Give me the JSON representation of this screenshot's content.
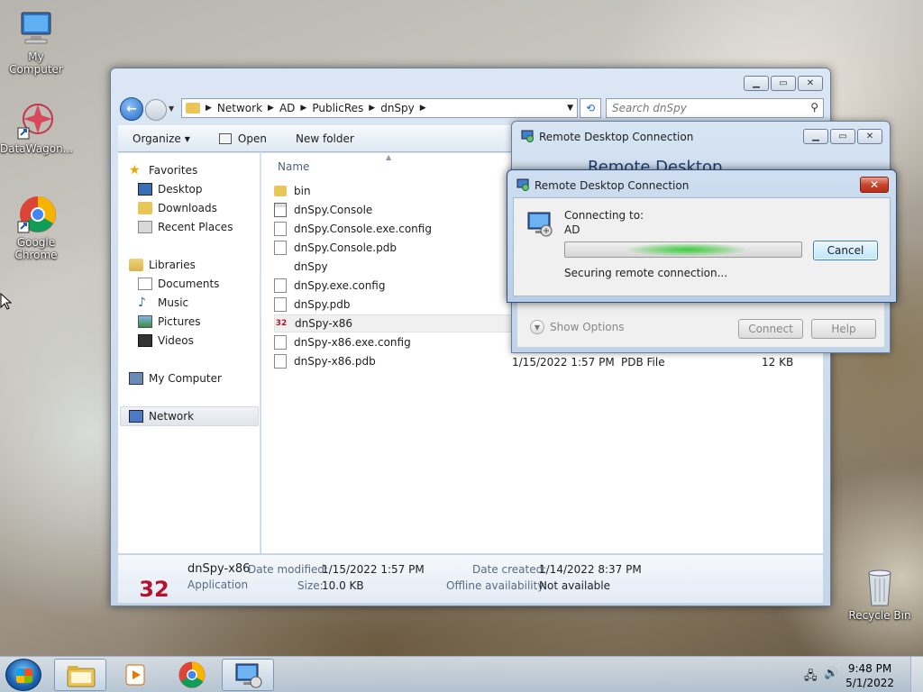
{
  "desktop": {
    "icons": [
      {
        "label": "My Computer"
      },
      {
        "label": "DataWagon..."
      },
      {
        "label": "Google Chrome"
      },
      {
        "label": "Recycle Bin"
      }
    ]
  },
  "explorer": {
    "breadcrumb": [
      "Network",
      "AD",
      "PublicRes",
      "dnSpy"
    ],
    "search_placeholder": "Search dnSpy",
    "toolbar": {
      "organize": "Organize",
      "open": "Open",
      "new_folder": "New folder"
    },
    "nav": {
      "favorites": "Favorites",
      "desktop": "Desktop",
      "downloads": "Downloads",
      "recent": "Recent Places",
      "libraries": "Libraries",
      "documents": "Documents",
      "music": "Music",
      "pictures": "Pictures",
      "videos": "Videos",
      "my_computer": "My Computer",
      "network": "Network"
    },
    "column_name": "Name",
    "files": [
      {
        "name": "bin",
        "icon": "folder"
      },
      {
        "name": "dnSpy.Console",
        "icon": "exe"
      },
      {
        "name": "dnSpy.Console.exe.config",
        "icon": "doc"
      },
      {
        "name": "dnSpy.Console.pdb",
        "icon": "doc"
      },
      {
        "name": "dnSpy",
        "icon": "blank"
      },
      {
        "name": "dnSpy.exe.config",
        "icon": "doc"
      },
      {
        "name": "dnSpy.pdb",
        "icon": "doc"
      },
      {
        "name": "dnSpy-x86",
        "icon": "x86",
        "badge": "32"
      },
      {
        "name": "dnSpy-x86.exe.config",
        "icon": "doc"
      },
      {
        "name": "dnSpy-x86.pdb",
        "icon": "doc",
        "date": "1/15/2022 1:57 PM",
        "type": "PDB File",
        "size": "12 KB"
      }
    ],
    "details": {
      "badge": "32",
      "name": "dnSpy-x86",
      "kind": "Application",
      "date_modified_label": "Date modified:",
      "date_modified": "1/15/2022 1:57 PM",
      "size_label": "Size:",
      "size": "10.0 KB",
      "date_created_label": "Date created:",
      "date_created": "1/14/2022 8:37 PM",
      "offline_label": "Offline availability:",
      "offline": "Not available"
    }
  },
  "rdc_back": {
    "title": "Remote Desktop Connection",
    "heading": "Remote Desktop",
    "show_options": "Show Options",
    "connect": "Connect",
    "help": "Help"
  },
  "rdc_front": {
    "title": "Remote Desktop Connection",
    "connecting_to": "Connecting to:",
    "host": "AD",
    "cancel": "Cancel",
    "status": "Securing remote connection..."
  },
  "taskbar": {
    "time": "9:48 PM",
    "date": "5/1/2022"
  }
}
